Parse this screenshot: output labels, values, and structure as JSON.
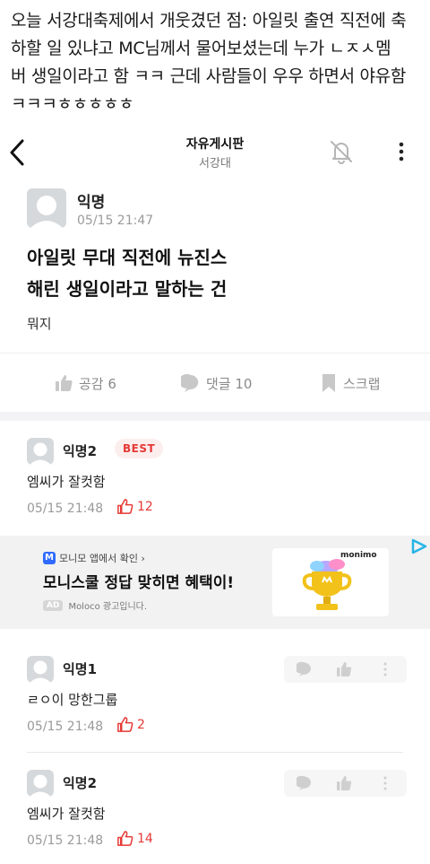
{
  "caption": {
    "lines": [
      "오늘 서강대축제에서 개웃겼던 점: 아일릿 출연 직전에 축",
      "하할 일 있냐고 MC님께서 물어보셨는데 누가 ㄴㅈㅅ멤",
      "버 생일이라고 함 ㅋㅋ 근데 사람들이 우우 하면서 야유함",
      "ㅋㅋㅋㅎㅎㅎㅎㅎ"
    ]
  },
  "appbar": {
    "title": "자유게시판",
    "subtitle": "서강대"
  },
  "post": {
    "author": "익명",
    "time": "05/15 21:47",
    "title_lines": [
      "아일릿 무대 직전에 뉴진스",
      "해린 생일이라고 말하는 건"
    ],
    "body": "뭐지"
  },
  "actions": {
    "like_label": "공감 6",
    "comment_label": "댓글 10",
    "scrap_label": "스크랩"
  },
  "comments": [
    {
      "author": "익명2",
      "badge": "BEST",
      "text": "엠씨가 잘컷함",
      "time": "05/15 21:48",
      "likes": "12"
    },
    {
      "author": "익명1",
      "text": "ㄹㅇ이 망한그룹",
      "time": "05/15 21:48",
      "likes": "2"
    },
    {
      "author": "익명2",
      "text": "엠씨가 잘컷함",
      "time": "05/15 21:48",
      "likes": "14"
    }
  ],
  "ad": {
    "brand_label": "모니모 앱에서 확인 ›",
    "brand_mark": "M",
    "headline": "모니스쿨 정답 맞히면 혜택이!",
    "ad_tag": "AD",
    "footer": "Moloco 광고입니다.",
    "logo_text": "monimo"
  },
  "colors": {
    "accent_red": "#e53935",
    "muted": "#9a9a9a",
    "gap": "#f3f3f5"
  }
}
